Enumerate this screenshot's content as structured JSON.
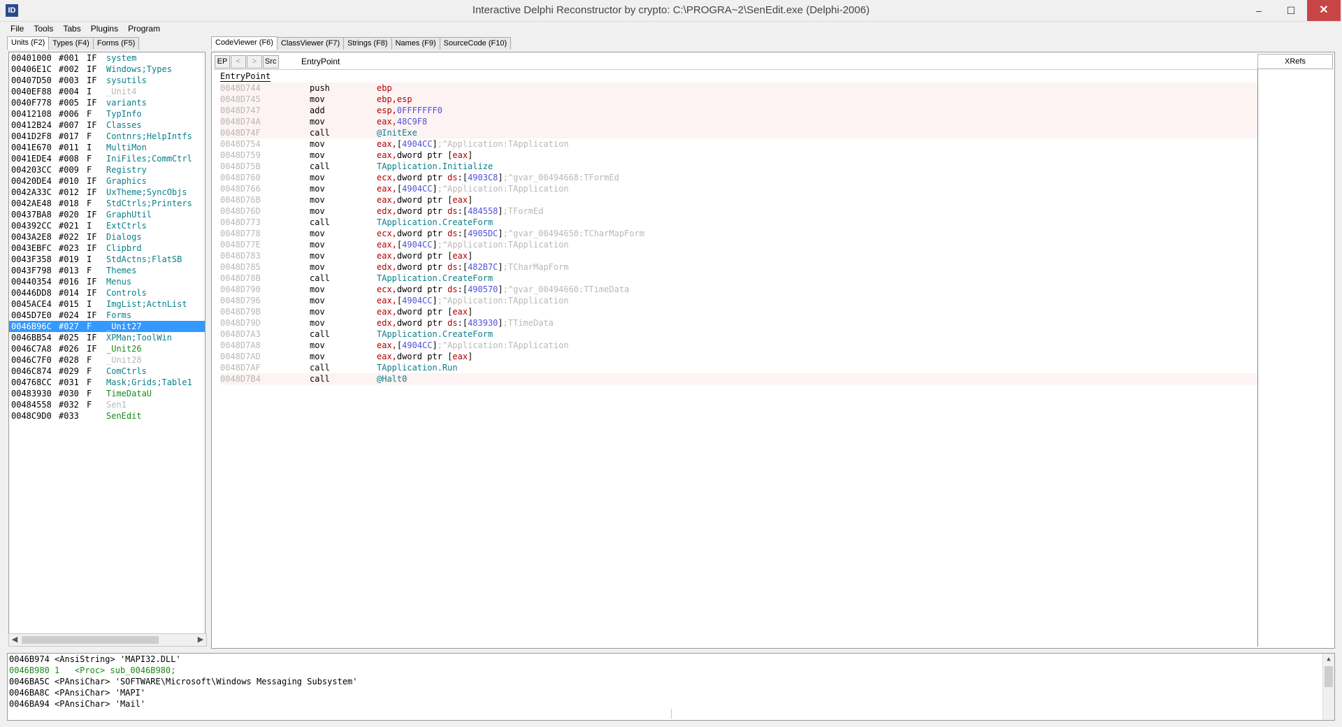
{
  "window": {
    "icon_text": "ID",
    "title": "Interactive Delphi Reconstructor by crypto: C:\\PROGRA~2\\SenEdit.exe (Delphi-2006)",
    "minimize": "–",
    "maximize": "☐",
    "close": "✕"
  },
  "menu": [
    "File",
    "Tools",
    "Tabs",
    "Plugins",
    "Program"
  ],
  "left_tabs": [
    "Units (F2)",
    "Types (F4)",
    "Forms (F5)"
  ],
  "units": [
    {
      "addr": "00401000",
      "num": "#001",
      "flags": "IF",
      "name": "system",
      "style": ""
    },
    {
      "addr": "00406E1C",
      "num": "#002",
      "flags": "IF",
      "name": "Windows;Types",
      "style": ""
    },
    {
      "addr": "00407D50",
      "num": "#003",
      "flags": "IF",
      "name": "sysutils",
      "style": ""
    },
    {
      "addr": "0040EF88",
      "num": "#004",
      "flags": "I",
      "name": "_Unit4",
      "style": "unk"
    },
    {
      "addr": "0040F778",
      "num": "#005",
      "flags": "IF",
      "name": "variants",
      "style": ""
    },
    {
      "addr": "00412108",
      "num": "#006",
      "flags": "F",
      "name": "TypInfo",
      "style": ""
    },
    {
      "addr": "00412B24",
      "num": "#007",
      "flags": "IF",
      "name": "Classes",
      "style": ""
    },
    {
      "addr": "0041D2F8",
      "num": "#017",
      "flags": "F",
      "name": "Contnrs;HelpIntfs",
      "style": ""
    },
    {
      "addr": "0041E670",
      "num": "#011",
      "flags": "I",
      "name": "MultiMon",
      "style": ""
    },
    {
      "addr": "0041EDE4",
      "num": "#008",
      "flags": "F",
      "name": "IniFiles;CommCtrl",
      "style": ""
    },
    {
      "addr": "004203CC",
      "num": "#009",
      "flags": "F",
      "name": "Registry",
      "style": ""
    },
    {
      "addr": "00420DE4",
      "num": "#010",
      "flags": "IF",
      "name": "Graphics",
      "style": ""
    },
    {
      "addr": "0042A33C",
      "num": "#012",
      "flags": "IF",
      "name": "UxTheme;SyncObjs",
      "style": ""
    },
    {
      "addr": "0042AE48",
      "num": "#018",
      "flags": "F",
      "name": "StdCtrls;Printers",
      "style": ""
    },
    {
      "addr": "00437BA8",
      "num": "#020",
      "flags": "IF",
      "name": "GraphUtil",
      "style": ""
    },
    {
      "addr": "004392CC",
      "num": "#021",
      "flags": "I",
      "name": "ExtCtrls",
      "style": ""
    },
    {
      "addr": "0043A2E8",
      "num": "#022",
      "flags": "IF",
      "name": "Dialogs",
      "style": ""
    },
    {
      "addr": "0043EBFC",
      "num": "#023",
      "flags": "IF",
      "name": "Clipbrd",
      "style": ""
    },
    {
      "addr": "0043F358",
      "num": "#019",
      "flags": "I",
      "name": "StdActns;FlatSB",
      "style": ""
    },
    {
      "addr": "0043F798",
      "num": "#013",
      "flags": "F",
      "name": "Themes",
      "style": ""
    },
    {
      "addr": "00440354",
      "num": "#016",
      "flags": "IF",
      "name": "Menus",
      "style": ""
    },
    {
      "addr": "00446DD8",
      "num": "#014",
      "flags": "IF",
      "name": "Controls",
      "style": ""
    },
    {
      "addr": "0045ACE4",
      "num": "#015",
      "flags": "I",
      "name": "ImgList;ActnList",
      "style": ""
    },
    {
      "addr": "0045D7E0",
      "num": "#024",
      "flags": "IF",
      "name": "Forms",
      "style": ""
    },
    {
      "addr": "0046B96C",
      "num": "#027",
      "flags": "F",
      "name": "_Unit27",
      "style": "sel"
    },
    {
      "addr": "0046BB54",
      "num": "#025",
      "flags": "IF",
      "name": "XPMan;ToolWin",
      "style": ""
    },
    {
      "addr": "0046C7A8",
      "num": "#026",
      "flags": "IF",
      "name": "_Unit26",
      "style": "grn"
    },
    {
      "addr": "0046C7F0",
      "num": "#028",
      "flags": "F",
      "name": "_Unit28",
      "style": "unk"
    },
    {
      "addr": "0046C874",
      "num": "#029",
      "flags": "F",
      "name": "ComCtrls",
      "style": ""
    },
    {
      "addr": "004768CC",
      "num": "#031",
      "flags": "F",
      "name": "Mask;Grids;Table1",
      "style": ""
    },
    {
      "addr": "00483930",
      "num": "#030",
      "flags": "F",
      "name": "TimeDataU",
      "style": "grn"
    },
    {
      "addr": "00484558",
      "num": "#032",
      "flags": "F",
      "name": "Sen1",
      "style": "unk"
    },
    {
      "addr": "0048C9D0",
      "num": "#033",
      "flags": "",
      "name": "SenEdit",
      "style": "grn"
    }
  ],
  "code_tabs": [
    "CodeViewer (F6)",
    "ClassViewer (F7)",
    "Strings (F8)",
    "Names (F9)",
    "SourceCode (F10)"
  ],
  "toolbar": {
    "ep": "EP",
    "back": "<",
    "fwd": ">",
    "src": "Src"
  },
  "proc_label": "EntryPoint",
  "proc_title": "EntryPoint",
  "xrefs": "XRefs",
  "code": [
    {
      "addr": "0048D744",
      "mn": "push",
      "hl": true,
      "ops": [
        [
          "reg",
          "ebp"
        ]
      ]
    },
    {
      "addr": "0048D745",
      "mn": "mov",
      "hl": true,
      "ops": [
        [
          "reg",
          "ebp,esp"
        ]
      ]
    },
    {
      "addr": "0048D747",
      "mn": "add",
      "hl": true,
      "ops": [
        [
          "reg",
          "esp,"
        ],
        [
          "num",
          "0FFFFFFF0"
        ]
      ]
    },
    {
      "addr": "0048D74A",
      "mn": "mov",
      "hl": true,
      "ops": [
        [
          "reg",
          "eax,"
        ],
        [
          "num",
          "48C9F8"
        ]
      ]
    },
    {
      "addr": "0048D74F",
      "mn": "call",
      "hl": true,
      "ops": [
        [
          "sym",
          "@InitExe"
        ]
      ]
    },
    {
      "addr": "0048D754",
      "mn": "mov",
      "hl": false,
      "ops": [
        [
          "reg",
          "eax,"
        ],
        [
          "kw",
          "["
        ],
        [
          "num",
          "4904CC"
        ],
        [
          "kw",
          "]"
        ],
        [
          "cmt",
          ";^Application:TApplication"
        ]
      ]
    },
    {
      "addr": "0048D759",
      "mn": "mov",
      "hl": false,
      "ops": [
        [
          "reg",
          "eax,"
        ],
        [
          "kw",
          "dword ptr ["
        ],
        [
          "reg",
          "eax"
        ],
        [
          "kw",
          "]"
        ]
      ]
    },
    {
      "addr": "0048D75B",
      "mn": "call",
      "hl": false,
      "ops": [
        [
          "sym",
          "TApplication.Initialize"
        ]
      ]
    },
    {
      "addr": "0048D760",
      "mn": "mov",
      "hl": false,
      "ops": [
        [
          "reg",
          "ecx,"
        ],
        [
          "kw",
          "dword ptr "
        ],
        [
          "reg",
          "ds"
        ],
        [
          "kw",
          ":["
        ],
        [
          "num",
          "4903C8"
        ],
        [
          "kw",
          "]"
        ],
        [
          "cmt",
          ";^gvar_00494668:TFormEd"
        ]
      ]
    },
    {
      "addr": "0048D766",
      "mn": "mov",
      "hl": false,
      "ops": [
        [
          "reg",
          "eax,"
        ],
        [
          "kw",
          "["
        ],
        [
          "num",
          "4904CC"
        ],
        [
          "kw",
          "]"
        ],
        [
          "cmt",
          ";^Application:TApplication"
        ]
      ]
    },
    {
      "addr": "0048D76B",
      "mn": "mov",
      "hl": false,
      "ops": [
        [
          "reg",
          "eax,"
        ],
        [
          "kw",
          "dword ptr ["
        ],
        [
          "reg",
          "eax"
        ],
        [
          "kw",
          "]"
        ]
      ]
    },
    {
      "addr": "0048D76D",
      "mn": "mov",
      "hl": false,
      "ops": [
        [
          "reg",
          "edx,"
        ],
        [
          "kw",
          "dword ptr "
        ],
        [
          "reg",
          "ds"
        ],
        [
          "kw",
          ":["
        ],
        [
          "num",
          "484558"
        ],
        [
          "kw",
          "]"
        ],
        [
          "cmt",
          ";TFormEd"
        ]
      ]
    },
    {
      "addr": "0048D773",
      "mn": "call",
      "hl": false,
      "ops": [
        [
          "sym",
          "TApplication.CreateForm"
        ]
      ]
    },
    {
      "addr": "0048D778",
      "mn": "mov",
      "hl": false,
      "ops": [
        [
          "reg",
          "ecx,"
        ],
        [
          "kw",
          "dword ptr "
        ],
        [
          "reg",
          "ds"
        ],
        [
          "kw",
          ":["
        ],
        [
          "num",
          "4905DC"
        ],
        [
          "kw",
          "]"
        ],
        [
          "cmt",
          ";^gvar_00494650:TCharMapForm"
        ]
      ]
    },
    {
      "addr": "0048D77E",
      "mn": "mov",
      "hl": false,
      "ops": [
        [
          "reg",
          "eax,"
        ],
        [
          "kw",
          "["
        ],
        [
          "num",
          "4904CC"
        ],
        [
          "kw",
          "]"
        ],
        [
          "cmt",
          ";^Application:TApplication"
        ]
      ]
    },
    {
      "addr": "0048D783",
      "mn": "mov",
      "hl": false,
      "ops": [
        [
          "reg",
          "eax,"
        ],
        [
          "kw",
          "dword ptr ["
        ],
        [
          "reg",
          "eax"
        ],
        [
          "kw",
          "]"
        ]
      ]
    },
    {
      "addr": "0048D785",
      "mn": "mov",
      "hl": false,
      "ops": [
        [
          "reg",
          "edx,"
        ],
        [
          "kw",
          "dword ptr "
        ],
        [
          "reg",
          "ds"
        ],
        [
          "kw",
          ":["
        ],
        [
          "num",
          "482B7C"
        ],
        [
          "kw",
          "]"
        ],
        [
          "cmt",
          ";TCharMapForm"
        ]
      ]
    },
    {
      "addr": "0048D78B",
      "mn": "call",
      "hl": false,
      "ops": [
        [
          "sym",
          "TApplication.CreateForm"
        ]
      ]
    },
    {
      "addr": "0048D790",
      "mn": "mov",
      "hl": false,
      "ops": [
        [
          "reg",
          "ecx,"
        ],
        [
          "kw",
          "dword ptr "
        ],
        [
          "reg",
          "ds"
        ],
        [
          "kw",
          ":["
        ],
        [
          "num",
          "490570"
        ],
        [
          "kw",
          "]"
        ],
        [
          "cmt",
          ";^gvar_00494660:TTimeData"
        ]
      ]
    },
    {
      "addr": "0048D796",
      "mn": "mov",
      "hl": false,
      "ops": [
        [
          "reg",
          "eax,"
        ],
        [
          "kw",
          "["
        ],
        [
          "num",
          "4904CC"
        ],
        [
          "kw",
          "]"
        ],
        [
          "cmt",
          ";^Application:TApplication"
        ]
      ]
    },
    {
      "addr": "0048D79B",
      "mn": "mov",
      "hl": false,
      "ops": [
        [
          "reg",
          "eax,"
        ],
        [
          "kw",
          "dword ptr ["
        ],
        [
          "reg",
          "eax"
        ],
        [
          "kw",
          "]"
        ]
      ]
    },
    {
      "addr": "0048D79D",
      "mn": "mov",
      "hl": false,
      "ops": [
        [
          "reg",
          "edx,"
        ],
        [
          "kw",
          "dword ptr "
        ],
        [
          "reg",
          "ds"
        ],
        [
          "kw",
          ":["
        ],
        [
          "num",
          "483930"
        ],
        [
          "kw",
          "]"
        ],
        [
          "cmt",
          ";TTimeData"
        ]
      ]
    },
    {
      "addr": "0048D7A3",
      "mn": "call",
      "hl": false,
      "ops": [
        [
          "sym",
          "TApplication.CreateForm"
        ]
      ]
    },
    {
      "addr": "0048D7A8",
      "mn": "mov",
      "hl": false,
      "ops": [
        [
          "reg",
          "eax,"
        ],
        [
          "kw",
          "["
        ],
        [
          "num",
          "4904CC"
        ],
        [
          "kw",
          "]"
        ],
        [
          "cmt",
          ";^Application:TApplication"
        ]
      ]
    },
    {
      "addr": "0048D7AD",
      "mn": "mov",
      "hl": false,
      "ops": [
        [
          "reg",
          "eax,"
        ],
        [
          "kw",
          "dword ptr ["
        ],
        [
          "reg",
          "eax"
        ],
        [
          "kw",
          "]"
        ]
      ]
    },
    {
      "addr": "0048D7AF",
      "mn": "call",
      "hl": false,
      "ops": [
        [
          "sym",
          "TApplication.Run"
        ]
      ]
    },
    {
      "addr": "0048D7B4",
      "mn": "call",
      "hl": true,
      "ops": [
        [
          "sym",
          "@Halt0"
        ]
      ]
    }
  ],
  "bottom_rows": [
    {
      "text": "0046B974 <AnsiString> 'MAPI32.DLL'",
      "green": false
    },
    {
      "text": "0046B980 1   <Proc> sub_0046B980;",
      "green": true
    },
    {
      "text": "0046BA5C <PAnsiChar> 'SOFTWARE\\Microsoft\\Windows Messaging Subsystem'",
      "green": false
    },
    {
      "text": "0046BA8C <PAnsiChar> 'MAPI'",
      "green": false
    },
    {
      "text": "0046BA94 <PAnsiChar> 'Mail'",
      "green": false
    }
  ]
}
